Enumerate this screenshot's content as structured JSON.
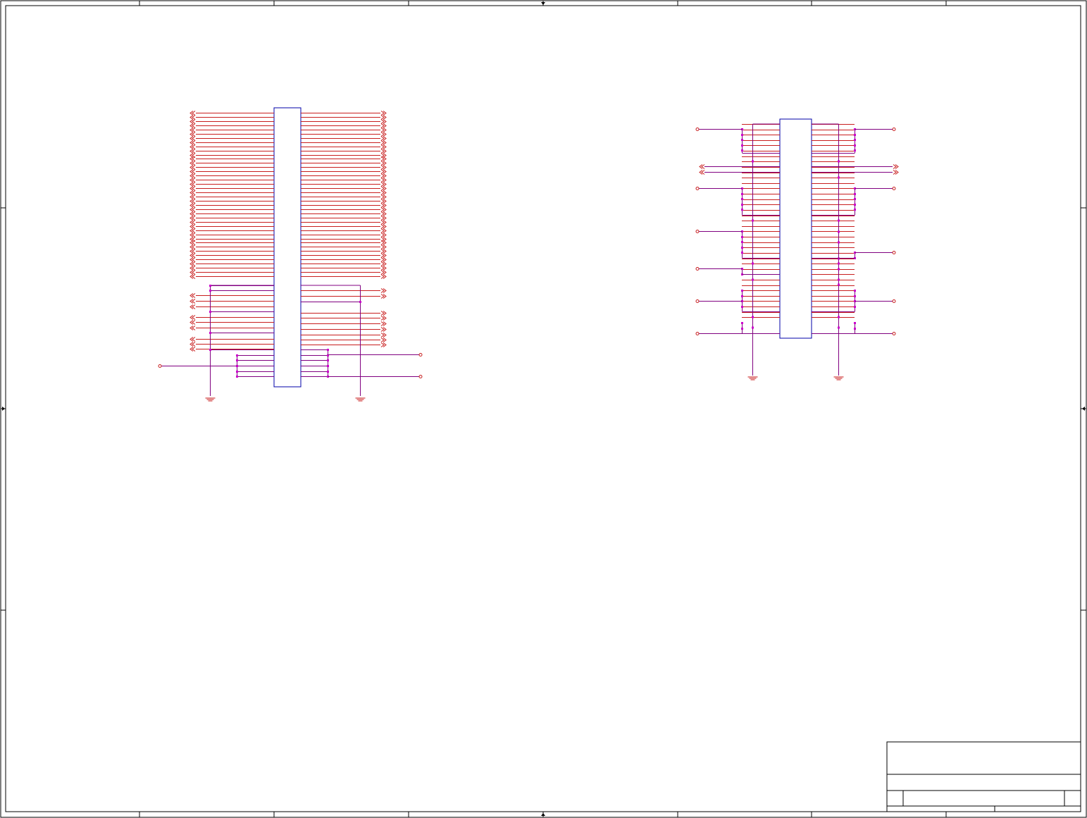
{
  "sheet": {
    "title": "",
    "colors": {
      "frame": "#000000",
      "component_body": "#0000a8",
      "pin": "#c81e1e",
      "wire": "#800080",
      "junction": "#cc00cc",
      "power_port": "#c81e1e"
    }
  },
  "schematic": {
    "left_connector": {
      "left_signal_pins": 40,
      "right_signal_pins": 40,
      "left_short_group_pins": [
        3,
        3,
        3
      ],
      "right_extra_signal_pins": 7,
      "bottom_bus_pins": 4,
      "ground_symbols": 2,
      "power_ports": 3
    },
    "right_connector": {
      "pins_per_side": 37,
      "bus_entries": 2,
      "power_ports": 11,
      "ground_symbols": 2
    }
  },
  "title_block": {
    "title": "",
    "sheet_number": ""
  }
}
